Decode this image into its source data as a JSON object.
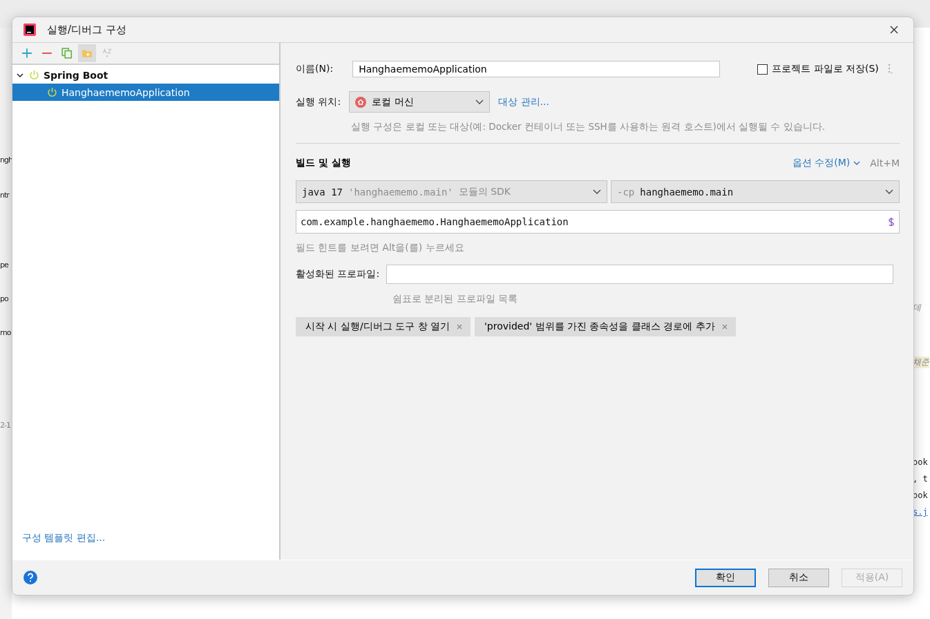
{
  "background": {
    "left_fragments": [
      "ngh",
      "ntr",
      "pe",
      "po",
      "mo",
      "2-1"
    ],
    "right_fragments": [
      {
        "text": "데",
        "kind": "comment"
      },
      {
        "text": "채준",
        "kind": "highlight"
      },
      {
        "text": "ook",
        "kind": "code"
      },
      {
        "text": ", t",
        "kind": "code"
      },
      {
        "text": "ook",
        "kind": "code"
      },
      {
        "text": "s.j",
        "kind": "link"
      }
    ]
  },
  "window": {
    "title": "실행/디버그 구성"
  },
  "toolbar": [
    {
      "kind": "add",
      "disabled": false,
      "pressed": false
    },
    {
      "kind": "remove",
      "disabled": false,
      "pressed": false
    },
    {
      "kind": "copy",
      "disabled": false,
      "pressed": false
    },
    {
      "kind": "folder",
      "disabled": false,
      "pressed": true
    },
    {
      "kind": "sort",
      "disabled": true,
      "pressed": false
    }
  ],
  "tree": [
    {
      "label": "Spring Boot",
      "expanded": true,
      "selected": false,
      "children": [
        {
          "label": "HanghaememoApplication",
          "selected": true
        }
      ]
    }
  ],
  "template_link": "구성 템플릿 편집...",
  "form": {
    "name_label": "이름(N):",
    "name_value": "HanghaememoApplication",
    "store_checkbox": {
      "label": "프로젝트 파일로 저장(S)",
      "checked": false
    },
    "run_on_label": "실행 위치:",
    "run_on_value": "로컬 머신",
    "manage_link": "대상 관리...",
    "run_on_hint": "실행 구성은 로컬 또는 대상(예: Docker 컨테이너 또는 SSH를 사용하는 원격 호스트)에서 실행될 수 있습니다.",
    "section_title": "빌드 및 실행",
    "modify_options": "옵션 수정(M)",
    "modify_shortcut": "Alt+M",
    "jdk": {
      "version": "java 17",
      "module": "'hanghaememo.main'",
      "suffix": "모듈의 SDK"
    },
    "classpath": {
      "flag": "-cp",
      "value": "hanghaememo.main"
    },
    "main_class": "com.example.hanghaememo.HanghaememoApplication",
    "field_hint": "필드 힌트를 보려면 Alt을(를) 누르세요",
    "profiles_label": "활성화된 프로파일:",
    "profiles_hint": "쉼표로 분리된 프로파일 목록",
    "chips": [
      "시작 시 실행/디버그 도구 창 열기",
      "'provided' 범위를 가진 종속성을 클래스 경로에 추가"
    ]
  },
  "buttons": [
    {
      "label": "확인",
      "kind": "default",
      "disabled": false
    },
    {
      "label": "취소",
      "kind": "normal",
      "disabled": false
    },
    {
      "label": "적용(A)",
      "kind": "normal",
      "disabled": true
    }
  ]
}
